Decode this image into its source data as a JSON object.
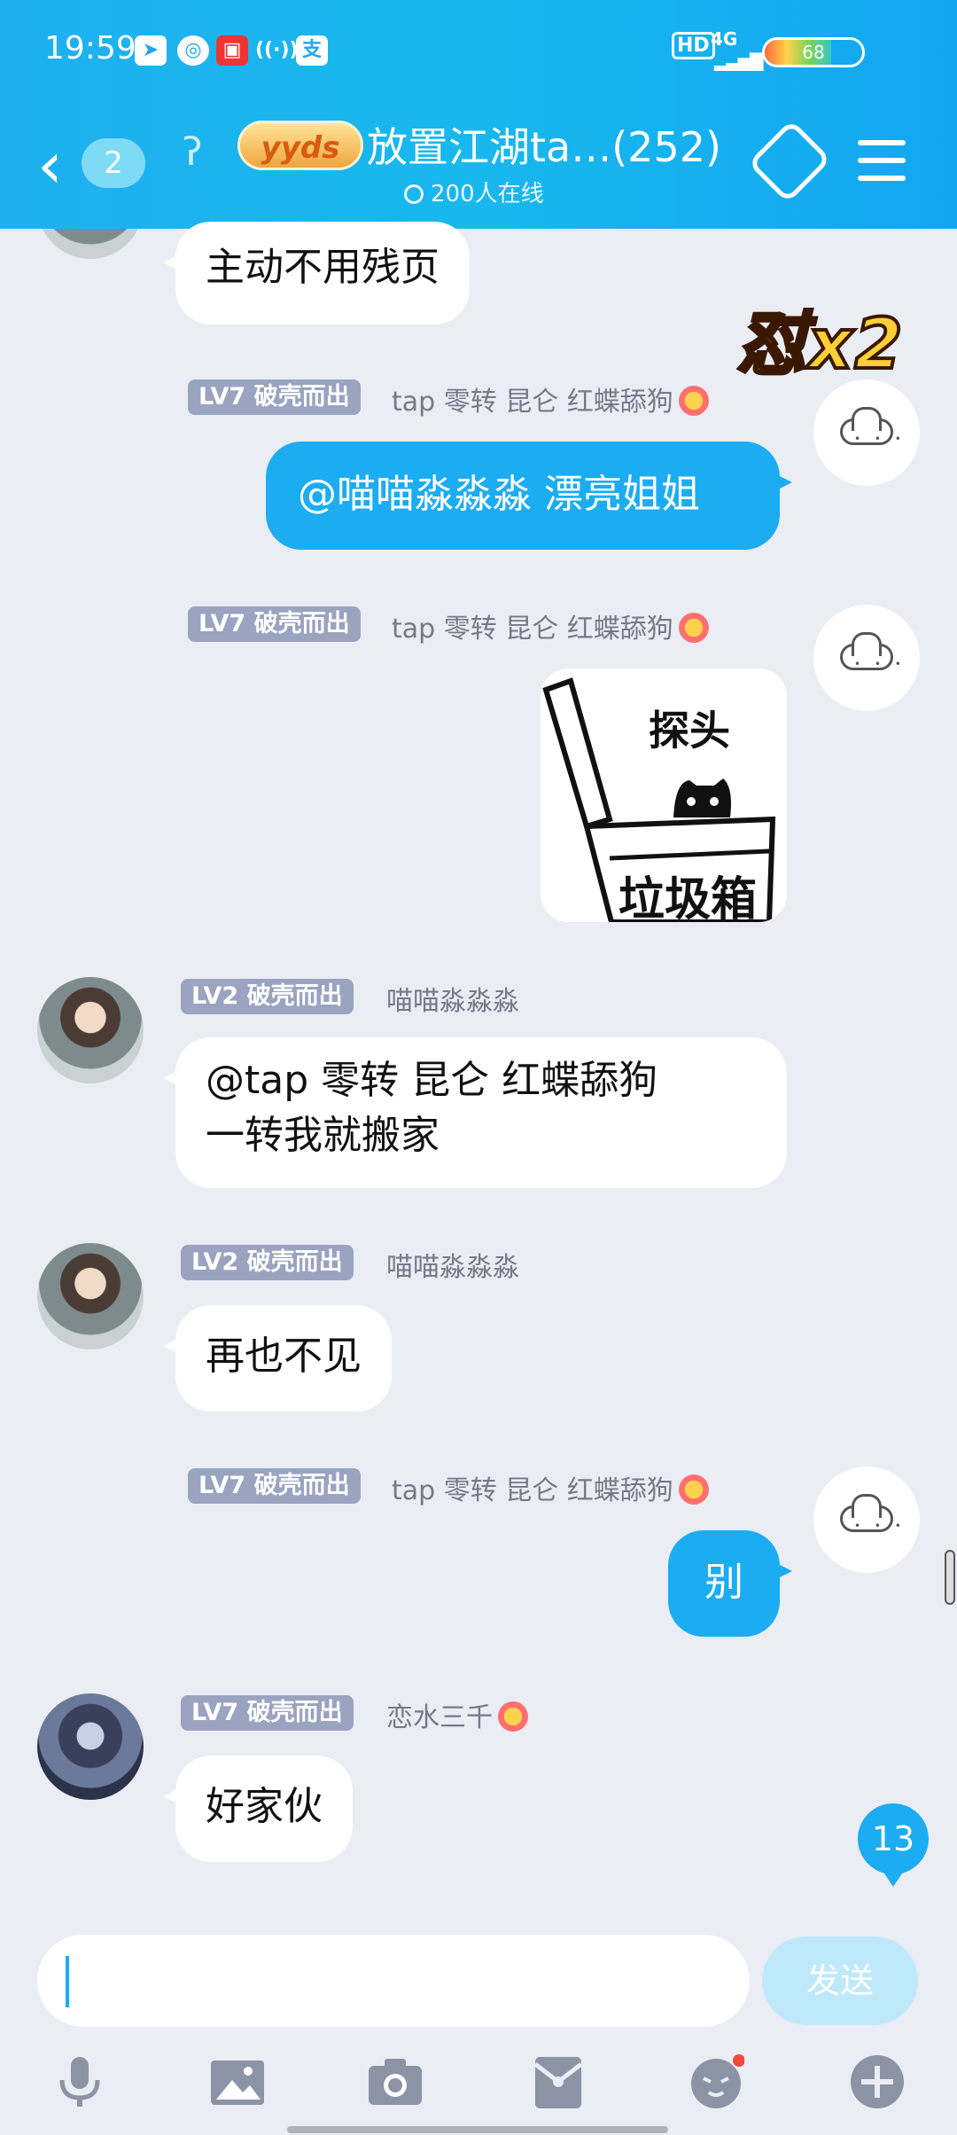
{
  "status_bar": {
    "time": "19:59",
    "left_icons": [
      "telegram-icon",
      "weibo-icon",
      "tv-app-icon",
      "hotspot-icon",
      "alipay-icon"
    ],
    "alipay_glyph": "支",
    "hd": "HD",
    "network": "4G",
    "battery": "68",
    "battery_level": 0.68
  },
  "header": {
    "back_icon": "chevron-left-icon",
    "unread_count": "2",
    "ear_icon": "ear-icon",
    "badge_text": "yyds",
    "title": "放置江湖ta…(252)",
    "online_text": "200人在线"
  },
  "combo": "怼x2",
  "messages": [
    {
      "side": "left",
      "text": "主动不用残页"
    },
    {
      "side": "right",
      "level": "LV7 破壳而出",
      "nick": "tap  零转 昆仑 红蝶舔狗",
      "text": "@喵喵淼淼淼 漂亮姐姐"
    },
    {
      "side": "right",
      "level": "LV7 破壳而出",
      "nick": "tap  零转 昆仑 红蝶舔狗",
      "sticker_text": [
        "探头",
        "垃圾箱"
      ]
    },
    {
      "side": "left",
      "level": "LV2 破壳而出",
      "nick": "喵喵淼淼淼",
      "lines": [
        "@tap  零转 昆仑 红蝶舔狗",
        "一转我就搬家"
      ]
    },
    {
      "side": "left",
      "level": "LV2 破壳而出",
      "nick": "喵喵淼淼淼",
      "text": "再也不见"
    },
    {
      "side": "right",
      "level": "LV7 破壳而出",
      "nick": "tap  零转 昆仑 红蝶舔狗",
      "text": "别"
    },
    {
      "side": "left",
      "level": "LV7 破壳而出",
      "nick": "恋水三千",
      "text": "好家伙"
    }
  ],
  "unread_new": "13",
  "input": {
    "value": "",
    "send_label": "发送"
  },
  "toolbar": [
    "microphone-icon",
    "image-icon",
    "camera-icon",
    "red-packet-icon",
    "emoji-icon",
    "plus-icon"
  ]
}
